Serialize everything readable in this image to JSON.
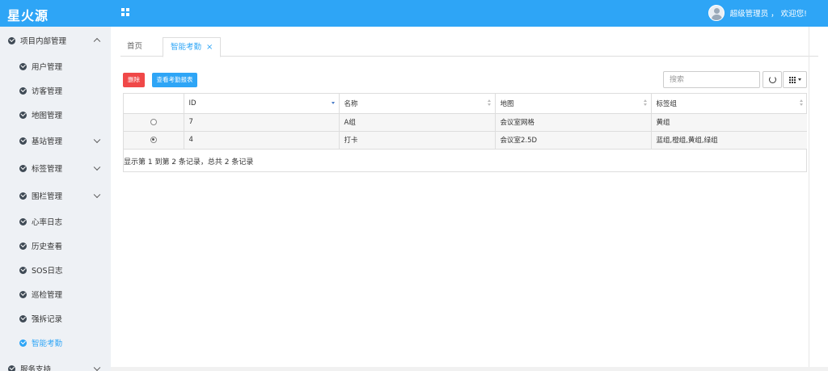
{
  "header": {
    "brand": "星火源",
    "welcome": "超级管理员 ， 欢迎您!"
  },
  "sidebar": {
    "group": "项目内部管理",
    "items": [
      {
        "label": "用户管理"
      },
      {
        "label": "访客管理"
      },
      {
        "label": "地图管理"
      },
      {
        "label": "基站管理"
      },
      {
        "label": "标签管理"
      },
      {
        "label": "围栏管理"
      },
      {
        "label": "心率日志"
      },
      {
        "label": "历史查看"
      },
      {
        "label": "SOS日志"
      },
      {
        "label": "巡检管理"
      },
      {
        "label": "强拆记录"
      },
      {
        "label": "智能考勤"
      }
    ],
    "footer_group": "服务支持"
  },
  "tabs": {
    "home": "首页",
    "current": "智能考勤",
    "close": "×"
  },
  "toolbar": {
    "delete_label": "删除",
    "report_label": "查看考勤报表",
    "search_placeholder": "搜索"
  },
  "table": {
    "headers": [
      "ID",
      "名称",
      "地图",
      "标签组"
    ],
    "rows": [
      {
        "id": "7",
        "name": "A组",
        "map": "会议室网格",
        "tags": "黄组",
        "selected": false
      },
      {
        "id": "4",
        "name": "打卡",
        "map": "会议室2.5D",
        "tags": "蓝组,橙组,黄组,绿组",
        "selected": true
      }
    ]
  },
  "pagination": {
    "info": "显示第 1 到第 2 条记录，总共 2 条记录"
  },
  "colors": {
    "accent": "#2ea5f6",
    "danger": "#f04848",
    "sidebar_bg": "#eef1f5"
  }
}
